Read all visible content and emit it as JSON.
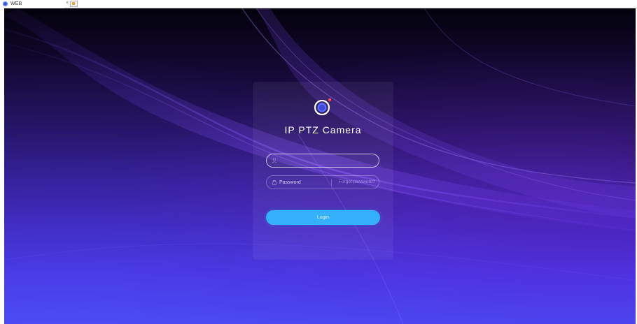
{
  "browser": {
    "tab_title": "WEB",
    "close_glyph": "×"
  },
  "login": {
    "title": "IP PTZ Camera",
    "username_placeholder": "",
    "password_placeholder": "Password",
    "forgot_password": "Forgot password?",
    "login_button": "Login"
  },
  "colors": {
    "accent": "#35b1fb",
    "background_top": "#04020c",
    "background_bottom": "#4c45ef",
    "logo_dot": "#ff4a4a"
  },
  "icons": {
    "tab": "browser-favicon",
    "logo": "camera-lens-icon",
    "username": "user-icon",
    "password": "lock-icon"
  }
}
